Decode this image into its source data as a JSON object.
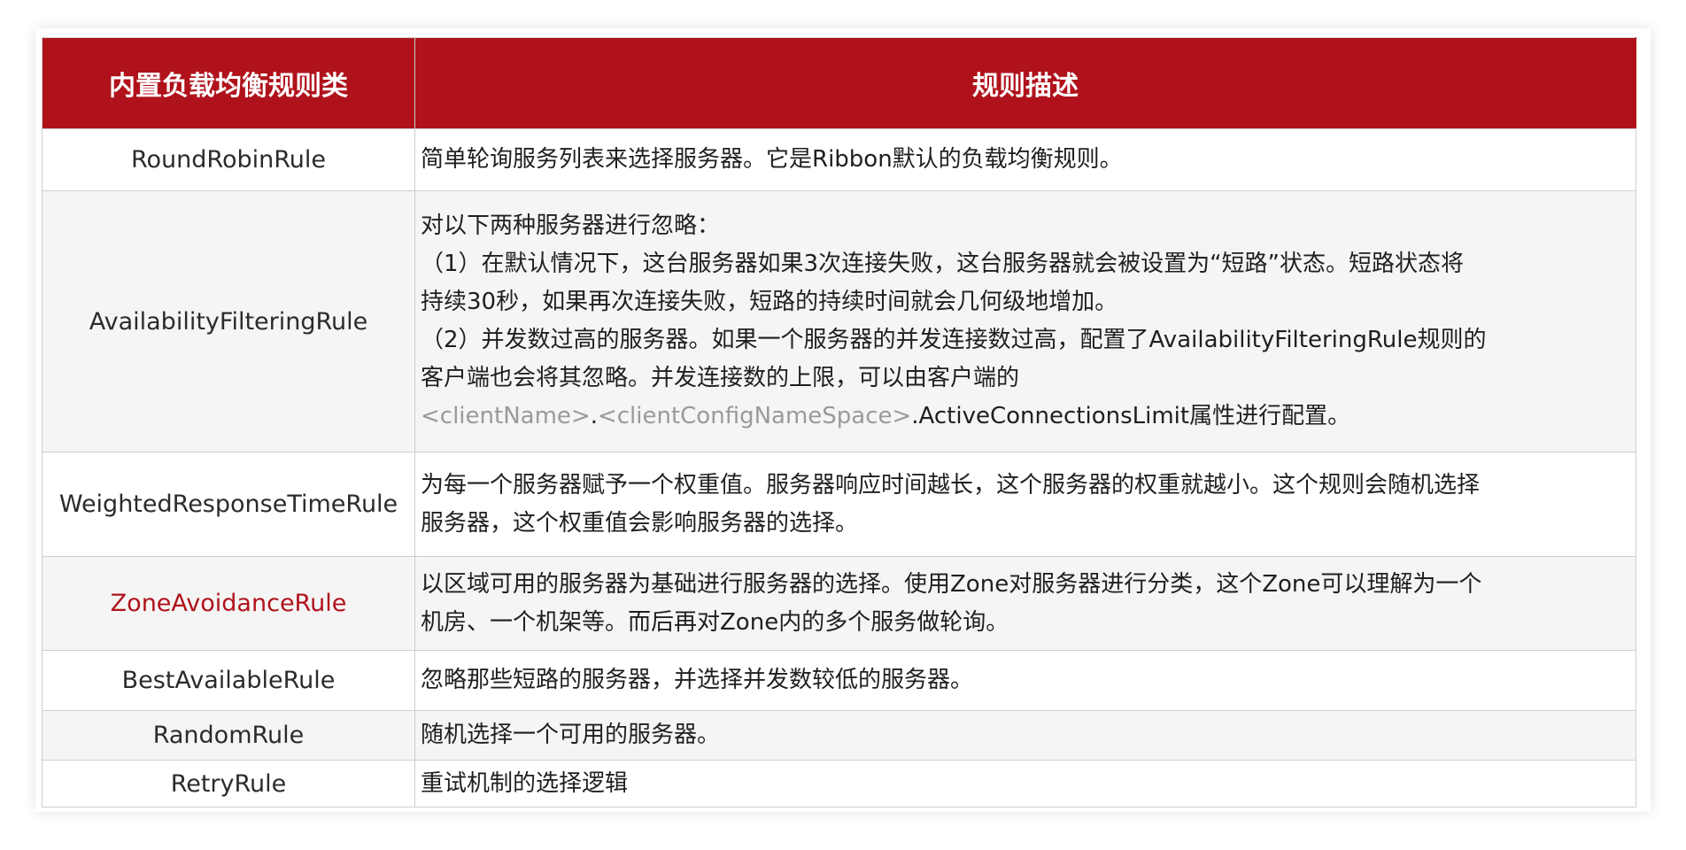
{
  "table": {
    "header": {
      "col1": "内置负载均衡规则类",
      "col2": "规则描述"
    },
    "rows": [
      {
        "name": "RoundRobinRule",
        "desc": [
          "简单轮询服务列表来选择服务器。它是Ribbon默认的负载均衡规则。"
        ]
      },
      {
        "name": "AvailabilityFilteringRule",
        "desc": [
          "对以下两种服务器进行忽略：",
          "（1）在默认情况下，这台服务器如果3次连接失败，这台服务器就会被设置为“短路”状态。短路状态将",
          "持续30秒，如果再次连接失败，短路的持续时间就会几何级地增加。",
          "（2）并发数过高的服务器。如果一个服务器的并发连接数过高，配置了AvailabilityFilteringRule规则的",
          "客户端也会将其忽略。并发连接数的上限，可以由客户端的"
        ],
        "desc_last": {
          "part1": "<clientName>",
          "part2": ".",
          "part3": "<clientConfigNameSpace>",
          "part4": ".ActiveConnectionsLimit属性进行配置。"
        }
      },
      {
        "name": "WeightedResponseTimeRule",
        "desc": [
          "为每一个服务器赋予一个权重值。服务器响应时间越长，这个服务器的权重就越小。这个规则会随机选择",
          "服务器，这个权重值会影响服务器的选择。"
        ]
      },
      {
        "name": "ZoneAvoidanceRule",
        "desc": [
          "以区域可用的服务器为基础进行服务器的选择。使用Zone对服务器进行分类，这个Zone可以理解为一个",
          "机房、一个机架等。而后再对Zone内的多个服务做轮询。"
        ]
      },
      {
        "name": "BestAvailableRule",
        "desc": [
          "忽略那些短路的服务器，并选择并发数较低的服务器。"
        ]
      },
      {
        "name": "RandomRule",
        "desc": [
          "随机选择一个可用的服务器。"
        ]
      },
      {
        "name": "RetryRule",
        "desc": [
          "重试机制的选择逻辑"
        ]
      }
    ]
  },
  "colors": {
    "header_bg": "#b0121b",
    "highlight_text": "#b0121b",
    "muted_text": "#9a9a9a"
  }
}
